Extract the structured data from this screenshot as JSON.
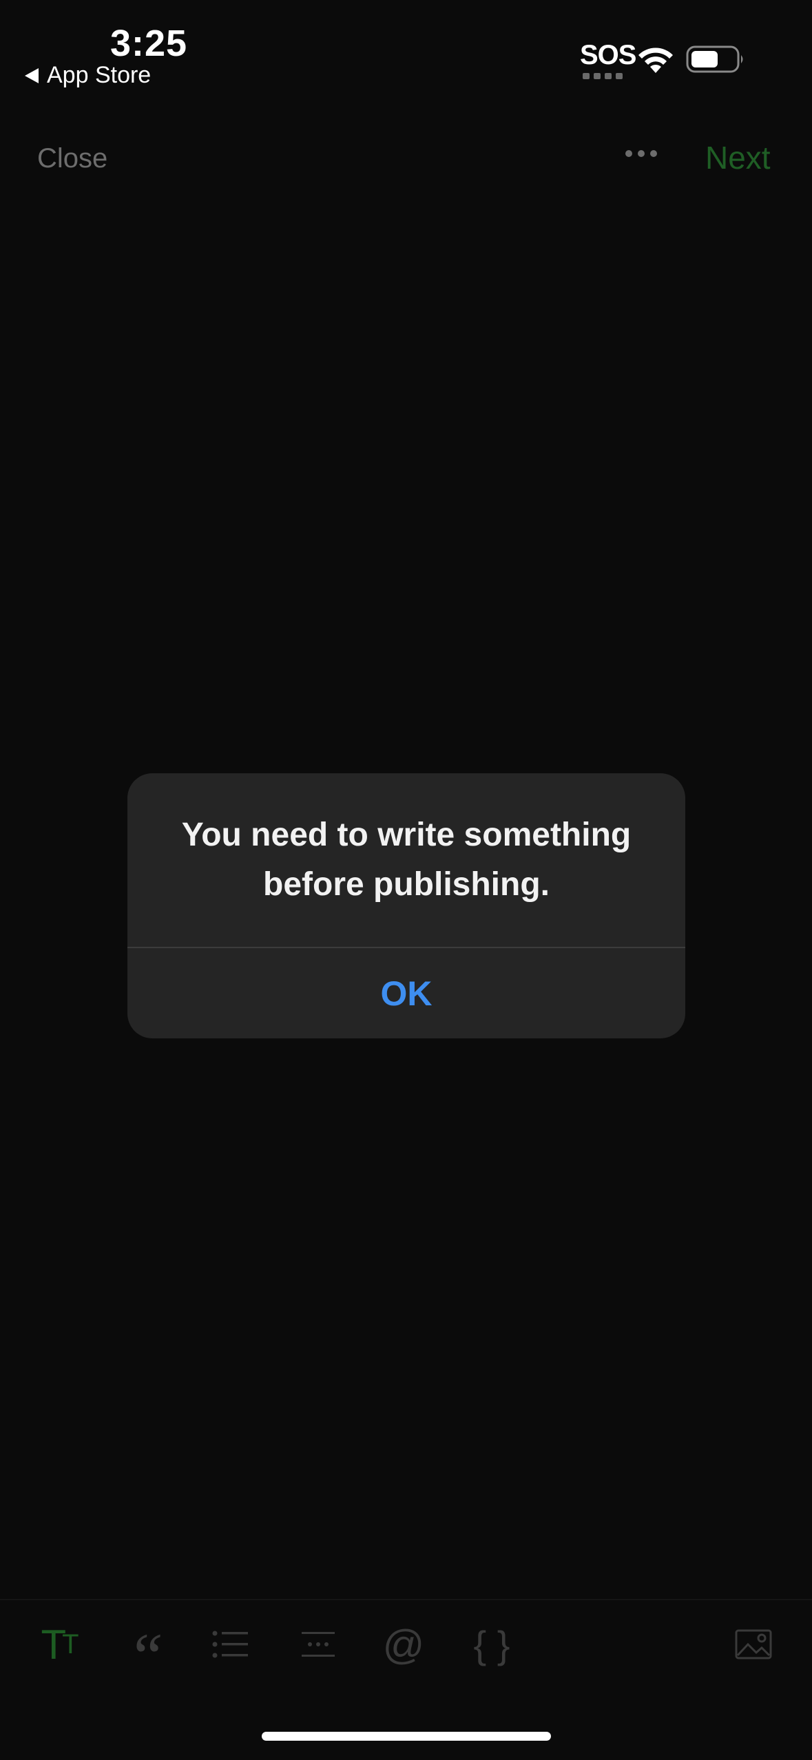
{
  "status_bar": {
    "time": "3:25",
    "back_label": "App Store",
    "sos": "SOS"
  },
  "nav": {
    "close_label": "Close",
    "next_label": "Next"
  },
  "alert": {
    "message": "You need to write something before publishing.",
    "ok_label": "OK"
  },
  "toolbar": {
    "icons": [
      "text-size-icon",
      "quote-icon",
      "list-icon",
      "divider-icon",
      "mention-icon",
      "code-braces-icon",
      "image-icon"
    ],
    "text_size_glyph": "T",
    "text_size_glyph_small": "T",
    "quote_glyph": "“",
    "at_glyph": "@",
    "braces_glyph": "{ }"
  },
  "colors": {
    "background": "#0b0b0b",
    "accent_green": "#1f5e25",
    "alert_bg": "#252525",
    "ok_blue": "#3e8ef0"
  }
}
